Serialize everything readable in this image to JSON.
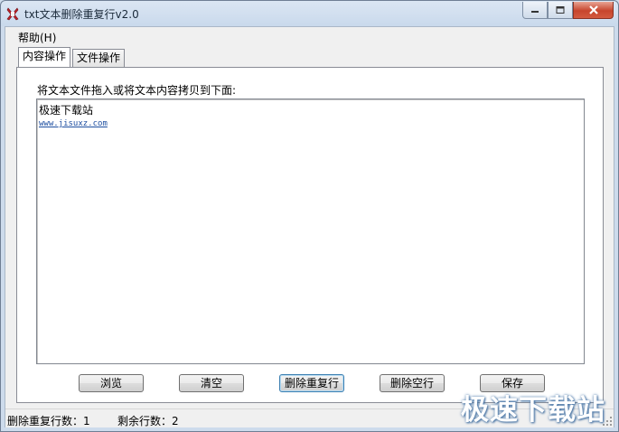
{
  "window": {
    "title": "txt文本删除重复行v2.0",
    "icons": {
      "app": "app-logo-icon",
      "minimize": "minimize-icon",
      "maximize": "maximize-icon",
      "close": "close-icon"
    }
  },
  "menubar": {
    "items": [
      {
        "label": "帮助(H)"
      }
    ]
  },
  "tabs": [
    {
      "label": "内容操作",
      "active": true
    },
    {
      "label": "文件操作",
      "active": false
    }
  ],
  "content": {
    "instruction": "将文本文件拖入或将文本内容拷贝到下面:",
    "text_lines": [
      "极速下载站",
      "www.jisuxz.com"
    ]
  },
  "buttons": {
    "browse": "浏览",
    "clear": "清空",
    "remove_duplicates": "删除重复行",
    "remove_blank": "删除空行",
    "save": "保存"
  },
  "status": {
    "removed": "删除重复行数：1",
    "remaining": "剩余行数：2"
  },
  "watermark": "极速下载站",
  "colors": {
    "close_button": "#c7452d",
    "link_text": "#1d4ea0",
    "title_bar": "#c9d9ec"
  }
}
